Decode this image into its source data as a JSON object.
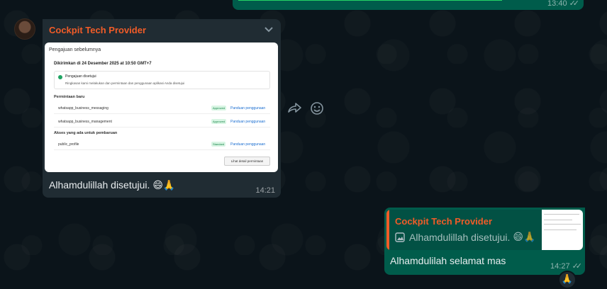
{
  "colors": {
    "background": "#0b141a",
    "incoming_bubble": "#202c33",
    "outgoing_bubble": "#005c4b",
    "sender_name": "#f15c28",
    "link": "#1c6fd1"
  },
  "top_message": {
    "time": "13:40",
    "status_icon": "double-check-icon"
  },
  "incoming": {
    "avatar_icon": "avatar-image",
    "sender": "Cockpit Tech Provider",
    "menu_icon": "chevron-down-icon",
    "screenshot": {
      "heading": "Pengajuan sebelumnya",
      "submitted": "Dikirimkan di 24 Desember 2025 at 10:50 GMT+7",
      "approval_title": "Pengajuan disetujui",
      "approval_desc": "Ringkasan kami melakukan dan permintaan dan penggunaan aplikasi Anda disetujui",
      "new_requests_title": "Permintaan baru",
      "rows": [
        {
          "name": "whatsapp_business_messaging",
          "badge": "Approved",
          "link": "Panduan penggunaan"
        },
        {
          "name": "whatsapp_business_management",
          "badge": "Approved",
          "link": "Panduan penggunaan"
        }
      ],
      "existing_title": "Akses yang ada untuk pembaruan",
      "existing_rows": [
        {
          "name": "public_profile",
          "badge": "Standard",
          "link": "Panduan penggunaan"
        }
      ],
      "detail_button": "Lihat detail permintaan"
    },
    "text": "Alhamdulillah disetujui.",
    "emojis": "😄🙏",
    "time": "14:21"
  },
  "actions": {
    "forward_icon": "forward-icon",
    "react_icon": "emoji-smile-icon"
  },
  "outgoing": {
    "quote_sender": "Cockpit Tech Provider",
    "quote_icon": "image-icon",
    "quote_text": "Alhamdulillah disetujui.",
    "quote_emojis": "😄🙏",
    "text": "Alhamdulilah selamat mas",
    "time": "14:27",
    "status_icon": "double-check-icon",
    "reaction": "🙏"
  }
}
